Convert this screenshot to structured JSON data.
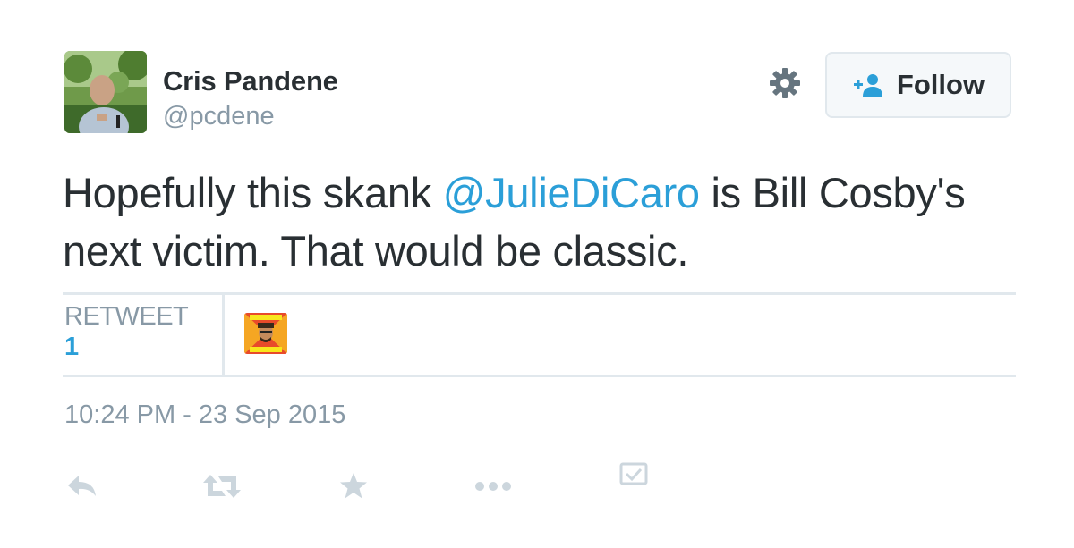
{
  "tweet": {
    "author_name": "Cris Pandene",
    "author_handle": "@pcdene",
    "text_before": "Hopefully this skank ",
    "mention": "@JulieDiCaro",
    "text_after": " is Bill Cosby's next victim. That would be classic.",
    "timestamp": "10:24 PM - 23 Sep 2015"
  },
  "follow_button": {
    "label": "Follow",
    "icon": "add-user-icon"
  },
  "settings": {
    "icon": "gear-icon"
  },
  "stats": {
    "retweet_label": "RETWEET",
    "retweet_count": "1"
  },
  "actions": [
    {
      "name": "reply",
      "icon": "reply-icon"
    },
    {
      "name": "retweet",
      "icon": "retweet-icon"
    },
    {
      "name": "favorite",
      "icon": "star-icon"
    },
    {
      "name": "more",
      "icon": "more-icon"
    },
    {
      "name": "embed",
      "icon": "checkbox-icon"
    }
  ],
  "colors": {
    "text": "#292f33",
    "muted": "#8899a6",
    "link": "#2b9fd8",
    "divider": "#e1e8ed",
    "action_icon": "#ccd6dd"
  }
}
